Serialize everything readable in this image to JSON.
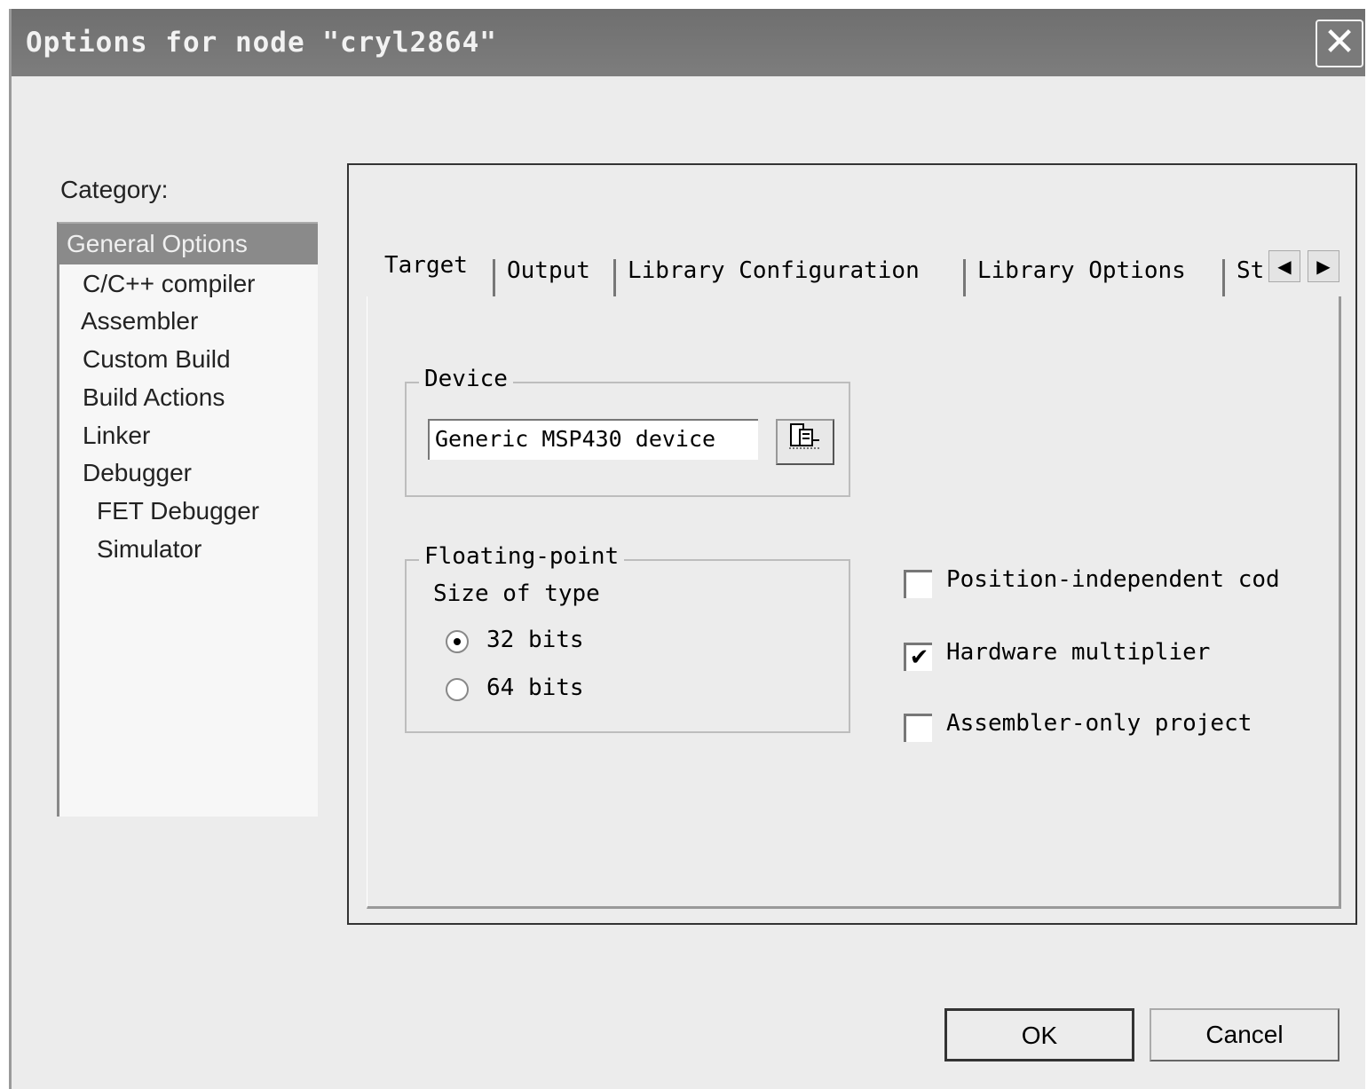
{
  "window": {
    "title": "Options for node \"cryl2864\"",
    "close_glyph": "✕"
  },
  "category": {
    "label": "Category:",
    "items": [
      {
        "label": "General Options",
        "selected": true
      },
      {
        "label": "C/C++ compiler"
      },
      {
        "label": "Assembler"
      },
      {
        "label": "Custom Build"
      },
      {
        "label": "Build Actions"
      },
      {
        "label": "Linker"
      },
      {
        "label": "Debugger"
      },
      {
        "label": "FET Debugger"
      },
      {
        "label": "Simulator"
      }
    ]
  },
  "tabs": [
    {
      "label": "Target",
      "active": true
    },
    {
      "label": "Output"
    },
    {
      "label": "Library Configuration"
    },
    {
      "label": "Library Options"
    },
    {
      "label": "St"
    }
  ],
  "tab_scroll": {
    "left": "◀",
    "right": "▶"
  },
  "device": {
    "group_title": "Device",
    "value": "Generic MSP430 device",
    "browse_icon": "browse-device-icon"
  },
  "floating_point": {
    "group_title": "Floating-point",
    "size_label": "Size of type",
    "options": [
      {
        "label": "32 bits",
        "selected": true
      },
      {
        "label": "64 bits",
        "selected": false
      }
    ]
  },
  "checkboxes": [
    {
      "label": "Position-independent cod",
      "checked": false
    },
    {
      "label": "Hardware multiplier",
      "checked": true
    },
    {
      "label": "Assembler-only project",
      "checked": false
    }
  ],
  "buttons": {
    "ok": "OK",
    "cancel": "Cancel"
  }
}
